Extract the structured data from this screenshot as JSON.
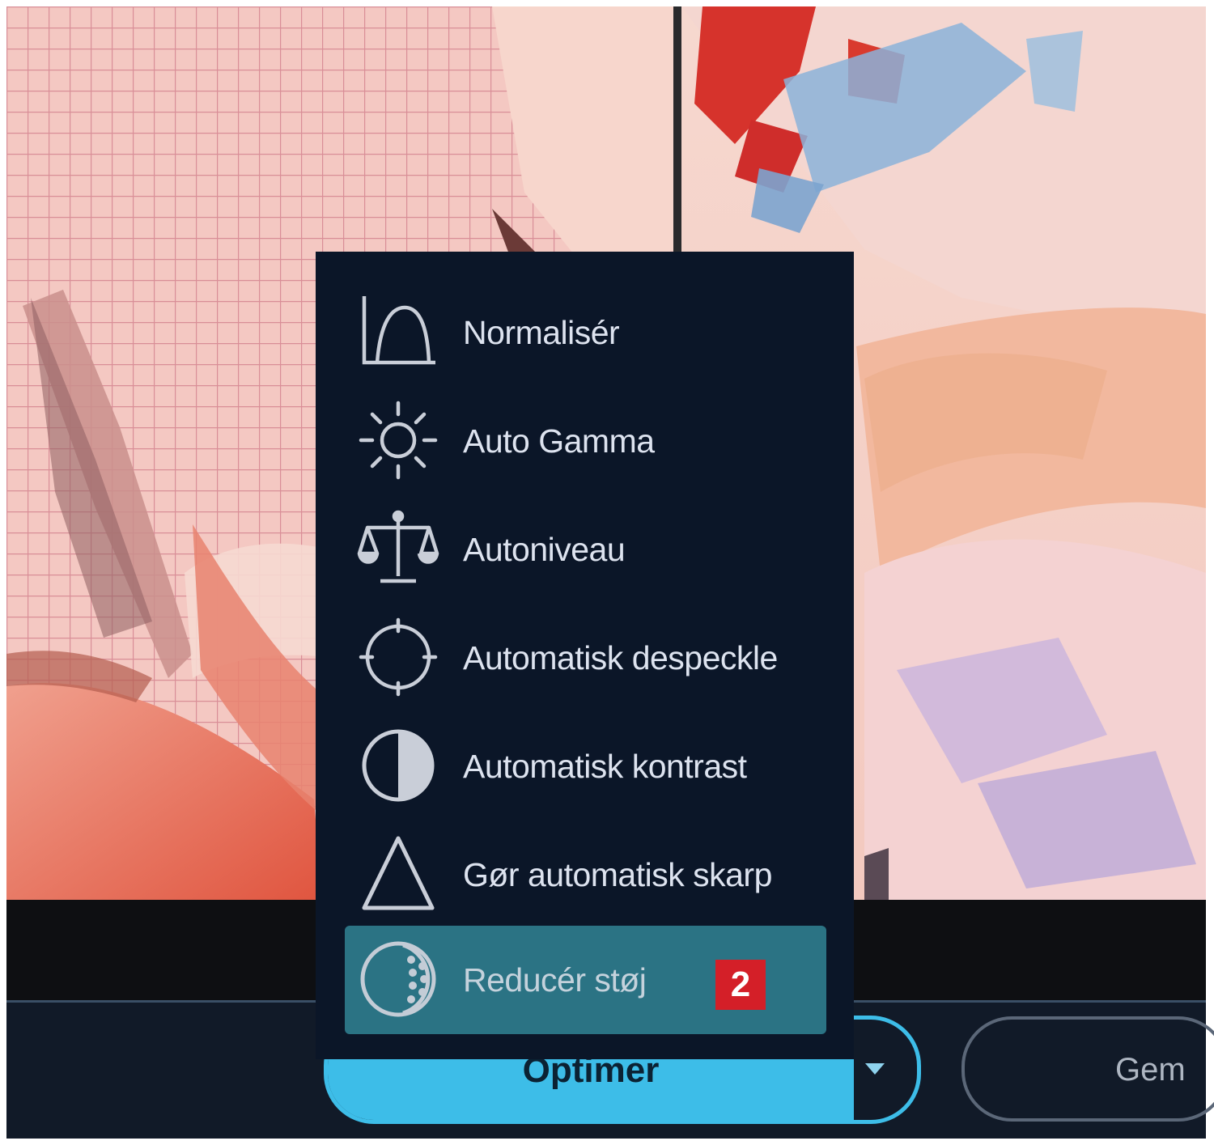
{
  "menu": {
    "items": [
      {
        "label": "Normalisér",
        "icon": "histogram-icon"
      },
      {
        "label": "Auto Gamma",
        "icon": "sun-icon"
      },
      {
        "label": "Autoniveau",
        "icon": "scales-icon"
      },
      {
        "label": "Automatisk despeckle",
        "icon": "crosshair-icon"
      },
      {
        "label": "Automatisk kontrast",
        "icon": "contrast-icon"
      },
      {
        "label": "Gør automatisk skarp",
        "icon": "triangle-icon"
      },
      {
        "label": "Reducér støj",
        "icon": "noise-icon",
        "selected": true
      }
    ],
    "badge": "2"
  },
  "toolbar": {
    "optimize_label": "Optimer",
    "save_label": "Gem"
  },
  "colors": {
    "menu_bg": "#0b1628",
    "selected_bg": "#2b7384",
    "accent": "#3dbde8",
    "badge": "#d41f28"
  }
}
